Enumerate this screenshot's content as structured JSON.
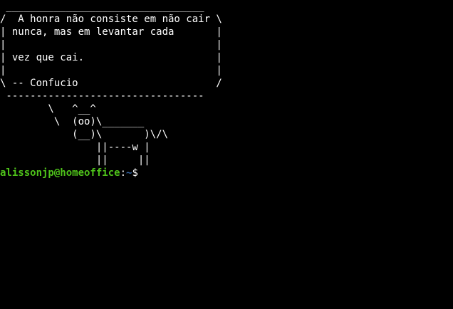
{
  "colors": {
    "background": "#000000",
    "text": "#ffffff",
    "prompt_user": "#4ec21a",
    "prompt_path": "#3465a4"
  },
  "terminal": {
    "output_lines": [
      " _________________________________",
      "/  A honra não consiste em não cair \\",
      "| nunca, mas em levantar cada       |",
      "|                                   |",
      "| vez que cai.                      |",
      "|                                   |",
      "\\ -- Confucio                       /",
      " ---------------------------------",
      "        \\   ^__^",
      "         \\  (oo)\\_______",
      "            (__)\\       )\\/\\",
      "                ||----w |",
      "                ||     ||"
    ],
    "prompt": {
      "user_host": "alissonjp@homeoffice",
      "separator": ":",
      "path": "~",
      "symbol": "$"
    }
  }
}
